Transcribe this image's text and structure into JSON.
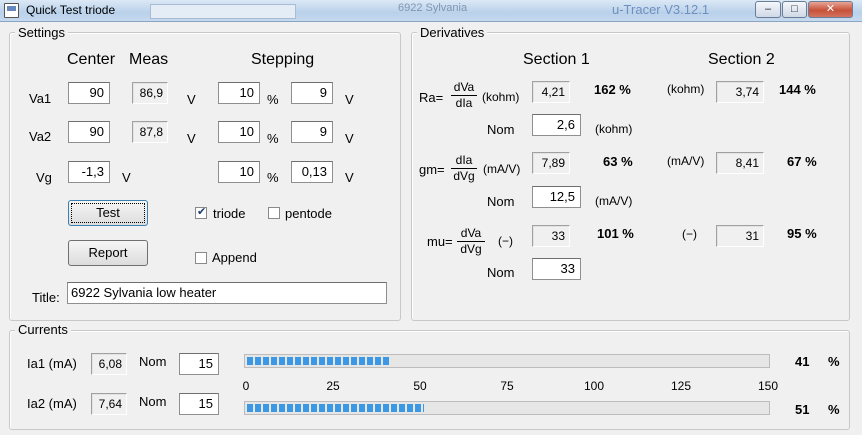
{
  "window": {
    "title": "Quick Test triode",
    "ghost_left": "6922 Sylvania",
    "ghost_right": "u-Tracer V3.12.1",
    "minimize": "–",
    "maximize": "□",
    "close": "✕"
  },
  "settings": {
    "group_title": "Settings",
    "headers": {
      "center": "Center",
      "meas": "Meas",
      "stepping": "Stepping"
    },
    "rows": [
      {
        "label": "Va1",
        "center": "90",
        "meas": "86,9",
        "unit": "V",
        "step_pct": "10",
        "pct": "%",
        "step_val": "9",
        "step_unit": "V"
      },
      {
        "label": "Va2",
        "center": "90",
        "meas": "87,8",
        "unit": "V",
        "step_pct": "10",
        "pct": "%",
        "step_val": "9",
        "step_unit": "V"
      },
      {
        "label": "Vg",
        "center": "-1,3",
        "unit": "V",
        "step_pct": "10",
        "pct": "%",
        "step_val": "0,13",
        "step_unit": "V"
      }
    ],
    "test_button": "Test",
    "report_button": "Report",
    "triode": {
      "label": "triode",
      "checked": true
    },
    "pentode": {
      "label": "pentode",
      "checked": false
    },
    "append": {
      "label": "Append",
      "checked": false
    },
    "title_label": "Title:",
    "title_value": "6922 Sylvania low heater"
  },
  "derivatives": {
    "group_title": "Derivatives",
    "section1": "Section 1",
    "section2": "Section 2",
    "ra": {
      "prefix": "Ra=",
      "num": "dVa",
      "den": "dIa",
      "unit": "(kohm)",
      "s1": "4,21",
      "s1_pct": "162  %",
      "unit2": "(kohm)",
      "s2": "3,74",
      "s2_pct": "144  %",
      "nom_label": "Nom",
      "nom": "2,6",
      "nom_unit": "(kohm)"
    },
    "gm": {
      "prefix": "gm=",
      "num": "dIa",
      "den": "dVg",
      "unit": "(mA/V)",
      "s1": "7,89",
      "s1_pct": "63  %",
      "unit2": "(mA/V)",
      "s2": "8,41",
      "s2_pct": "67  %",
      "nom_label": "Nom",
      "nom": "12,5",
      "nom_unit": "(mA/V)"
    },
    "mu": {
      "prefix": "mu=",
      "num": "dVa",
      "den": "dVg",
      "unit": "(−)",
      "s1": "33",
      "s1_pct": "101  %",
      "unit2": "(−)",
      "s2": "31",
      "s2_pct": "95  %",
      "nom_label": "Nom",
      "nom": "33"
    }
  },
  "currents": {
    "group_title": "Currents",
    "ia1": {
      "label": "Ia1 (mA)",
      "value": "6,08",
      "nom_label": "Nom",
      "nom": "15",
      "percent": 41,
      "pct_text": "41",
      "pct_sign": "%"
    },
    "ia2": {
      "label": "Ia2 (mA)",
      "value": "7,64",
      "nom_label": "Nom",
      "nom": "15",
      "percent": 51,
      "pct_text": "51",
      "pct_sign": "%"
    },
    "scale_ticks": [
      "0",
      "25",
      "50",
      "75",
      "100",
      "125",
      "150"
    ],
    "scale_max": 150
  },
  "colors": {
    "bar_fill": "#3c97e4",
    "window_bg": "#f0f0f0"
  }
}
